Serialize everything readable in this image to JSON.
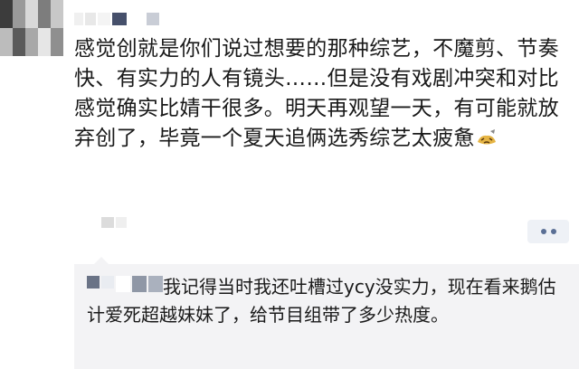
{
  "post": {
    "text": "感觉创就是你们说过想要的那种综艺，不魔剪、节奏快、有实力的人有镜头……但是没有戏剧冲突和对比感觉确实比婧干很多。明天再观望一天，有可能就放弃创了，毕竟一个夏天追俩选秀综艺太疲惫",
    "emoji": "tired-emoji-icon"
  },
  "reply": {
    "text": "我记得当时我还吐槽过ycy没实力，现在看来鹅估计爱死超越妹妹了，给节目组带了多少热度。"
  },
  "colors": {
    "accent": "#5a6f95",
    "reply_bg": "#f3f3f5"
  }
}
